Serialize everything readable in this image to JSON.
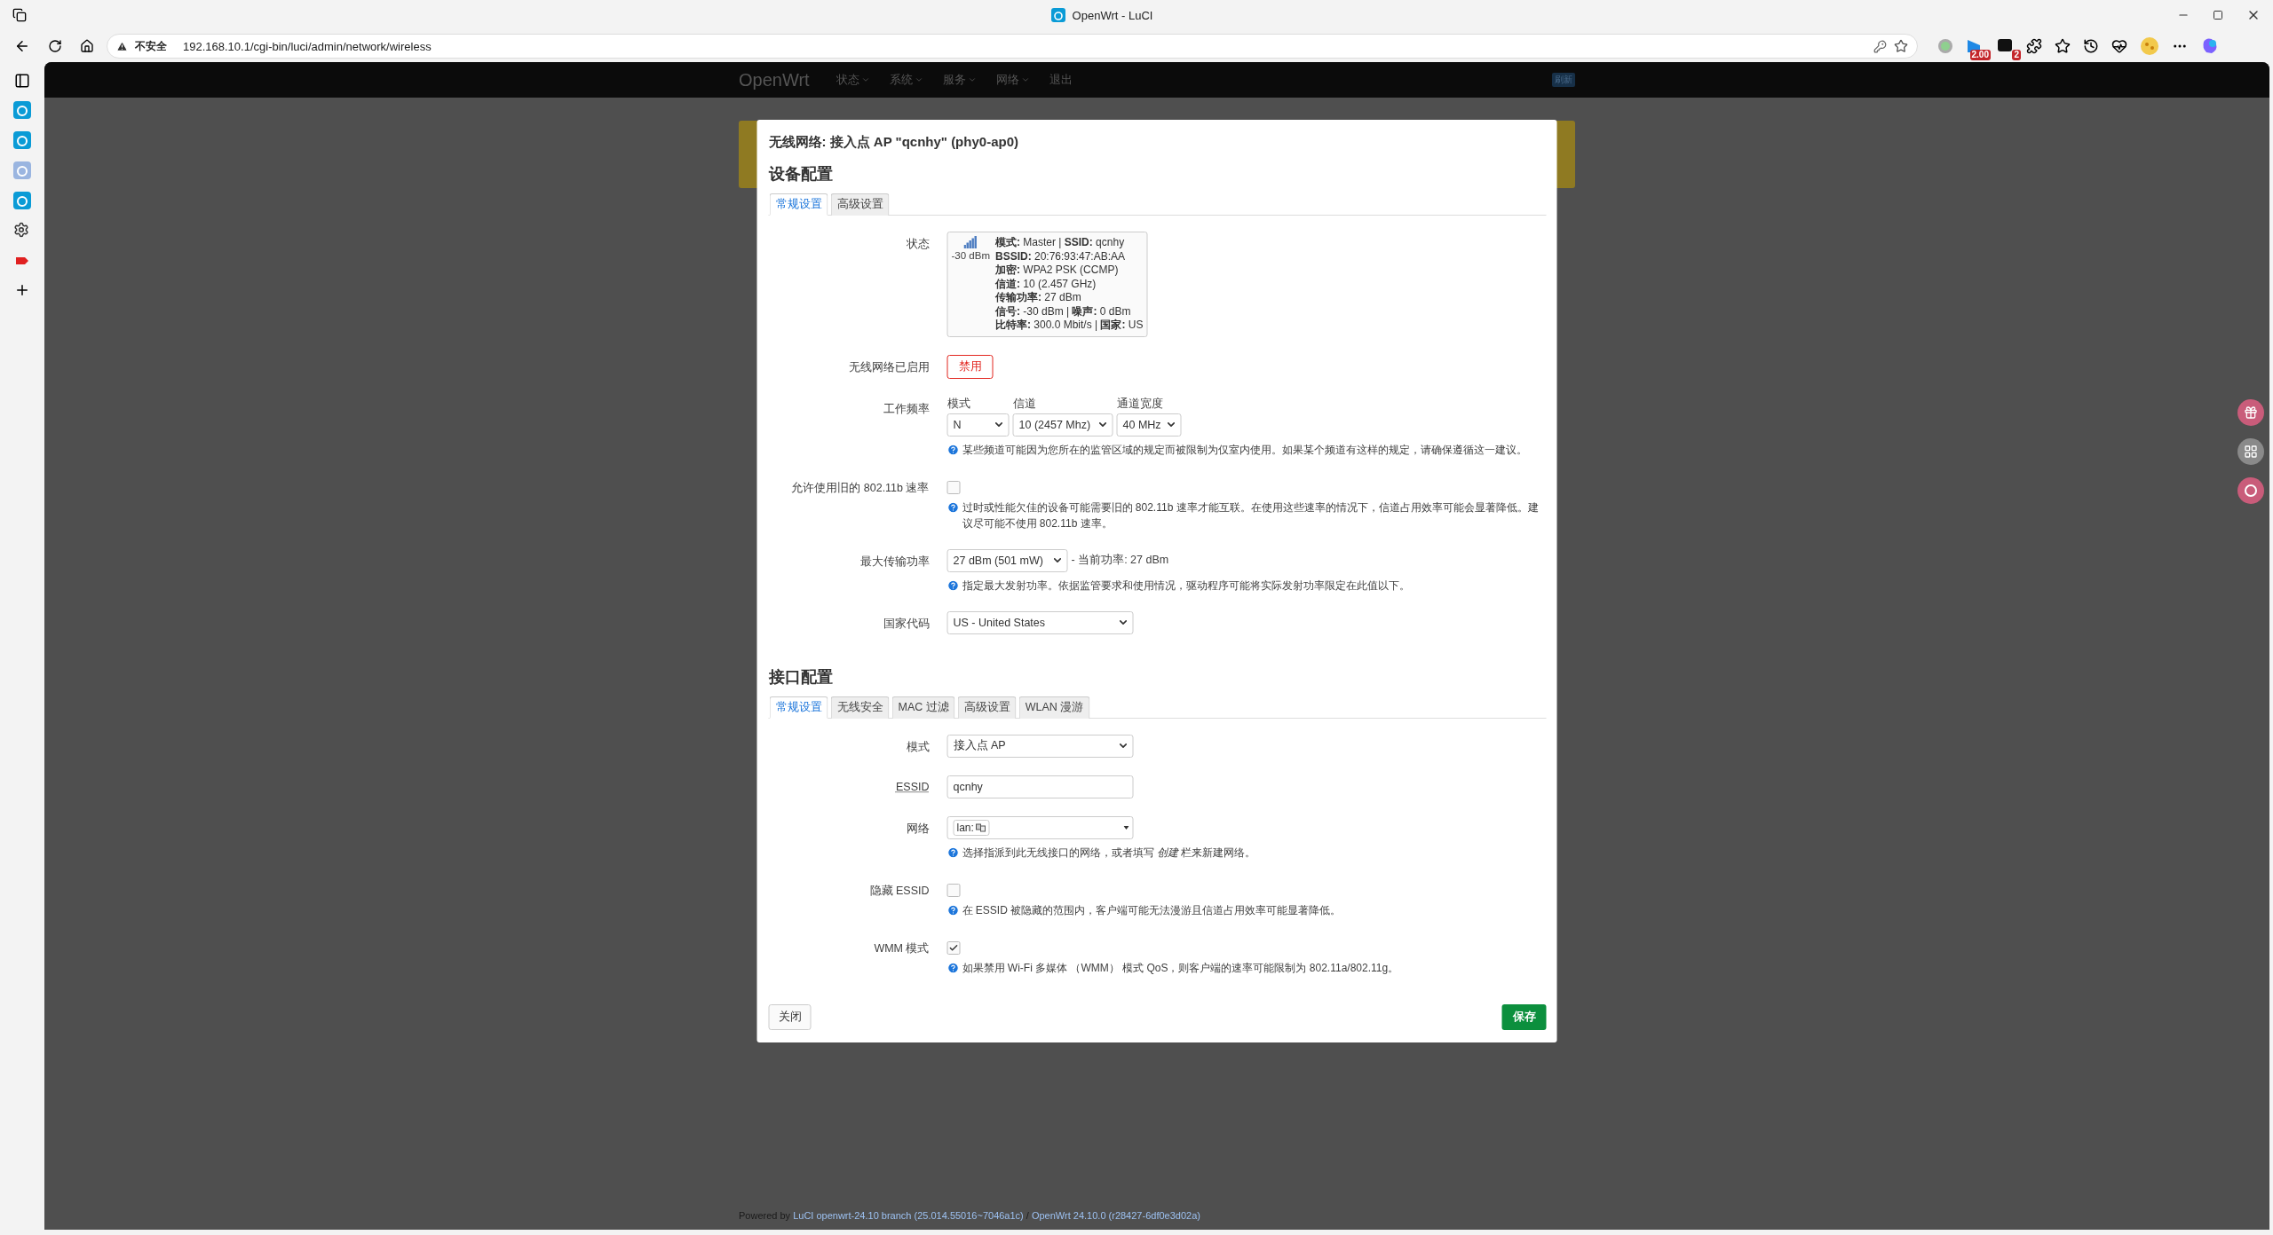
{
  "browser": {
    "tab_title": "OpenWrt - LuCI",
    "security": "不安全",
    "url": "192.168.10.1/cgi-bin/luci/admin/network/wireless",
    "badges": [
      "2.00",
      "2"
    ]
  },
  "navbar": {
    "brand": "OpenWrt",
    "menus": [
      {
        "label": "状态",
        "caret": true
      },
      {
        "label": "系统",
        "caret": true
      },
      {
        "label": "服务",
        "caret": true
      },
      {
        "label": "网络",
        "caret": true
      },
      {
        "label": "退出",
        "caret": false
      }
    ],
    "indicator": "刷新"
  },
  "modal": {
    "title": "无线网络: 接入点 AP \"qcnhy\" (phy0-ap0)",
    "sections": [
      {
        "heading": "设备配置",
        "tabs": [
          {
            "label": "常规设置",
            "selected": true
          },
          {
            "label": "高级设置",
            "selected": false
          }
        ],
        "rows": [
          {
            "kind": "status",
            "label": "状态",
            "signal": "-30 dBm",
            "lines": [
              "**模式:** Master | **SSID:** qcnhy",
              "**BSSID:** 20:76:93:47:AB:AA",
              "**加密:** WPA2 PSK (CCMP)",
              "**信道:** 10 (2.457 GHz)",
              "**传输功率:** 27 dBm",
              "**信号:** -30 dBm | **噪声:** 0 dBm",
              "**比特率:** 300.0 Mbit/s | **国家:** US"
            ]
          },
          {
            "kind": "button",
            "label": "无线网络已启用",
            "button": "禁用"
          },
          {
            "kind": "group",
            "label": "工作频率",
            "selects": [
              {
                "caption": "模式",
                "value": "N"
              },
              {
                "caption": "信道",
                "value": "10 (2457 Mhz)"
              },
              {
                "caption": "通道宽度",
                "value": "40 MHz"
              }
            ],
            "help": "某些频道可能因为您所在的监管区域的规定而被限制为仅室内使用。如果某个频道有这样的规定，请确保遵循这一建议。"
          },
          {
            "kind": "checkbox",
            "label": "允许使用旧的 802.11b 速率",
            "checked": false,
            "help": "过时或性能欠佳的设备可能需要旧的 802.11b 速率才能互联。在使用这些速率的情况下，信道占用效率可能会显著降低。建议尽可能不使用 802.11b 速率。"
          },
          {
            "kind": "select",
            "label": "最大传输功率",
            "value": "27 dBm (501 mW)",
            "note": "- 当前功率: 27 dBm",
            "help": "指定最大发射功率。依据监管要求和使用情况，驱动程序可能将实际发射功率限定在此值以下。"
          },
          {
            "kind": "select",
            "label": "国家代码",
            "value": "US - United States",
            "wide": true
          }
        ]
      },
      {
        "heading": "接口配置",
        "tabs": [
          {
            "label": "常规设置",
            "selected": true
          },
          {
            "label": "无线安全",
            "selected": false
          },
          {
            "label": "MAC 过滤",
            "selected": false
          },
          {
            "label": "高级设置",
            "selected": false
          },
          {
            "label": "WLAN 漫游",
            "selected": false
          }
        ],
        "rows": [
          {
            "kind": "select",
            "label": "模式",
            "value": "接入点 AP",
            "wide": true
          },
          {
            "kind": "text",
            "label": "ESSID",
            "abbr": true,
            "value": "qcnhy"
          },
          {
            "kind": "network",
            "label": "网络",
            "chip": "lan:",
            "help": "选择指派到此无线接口的网络，或者填写 *创建* 栏来新建网络。"
          },
          {
            "kind": "checkbox",
            "label": "隐藏 ESSID",
            "checked": false,
            "help": "在 ESSID 被隐藏的范围内，客户端可能无法漫游且信道占用效率可能显著降低。"
          },
          {
            "kind": "checkbox",
            "label": "WMM 模式",
            "checked": true,
            "help": "如果禁用 Wi-Fi 多媒体 （WMM） 模式 QoS，则客户端的速率可能限制为 802.11a/802.11g。"
          }
        ]
      }
    ],
    "close": "关闭",
    "save": "保存"
  },
  "footer": {
    "prefix": "Powered by ",
    "link_1": "LuCI openwrt-24.10 branch (25.014.55016~7046a1c)",
    "separator": " / ",
    "link_2": "OpenWrt 24.10.0 (r28427-6df0e3d02a)"
  }
}
